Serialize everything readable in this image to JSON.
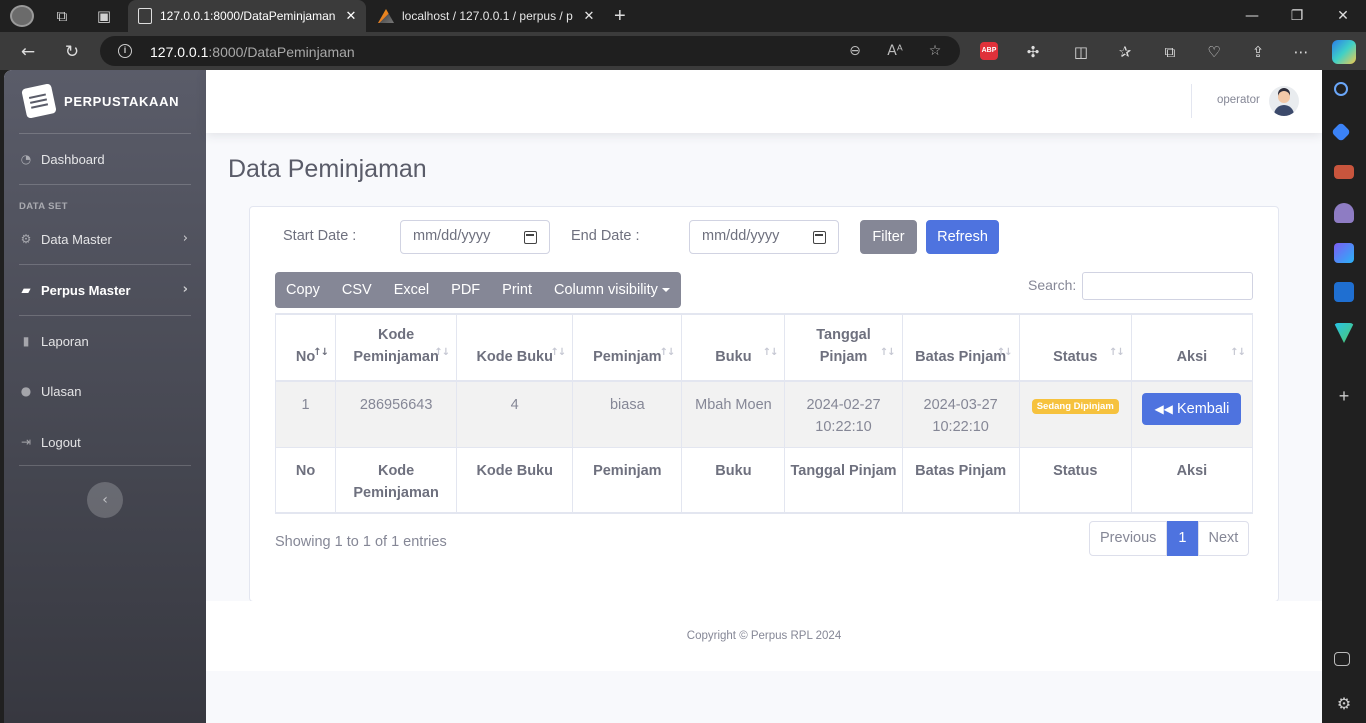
{
  "browser": {
    "tabs": [
      {
        "title": "127.0.0.1:8000/DataPeminjaman",
        "close": "✕"
      },
      {
        "title": "localhost / 127.0.0.1 / perpus / p",
        "close": "✕"
      }
    ],
    "new_tab": "+",
    "url_host": "127.0.0.1",
    "url_path": ":8000/DataPeminjaman",
    "abp_label": "ABP",
    "window_controls": {
      "minimize": "—",
      "maximize": "❐",
      "close": "✕"
    },
    "icons": {
      "workspaces": "workspaces-icon",
      "tab_actions": "tab-actions-icon",
      "back": "back-arrow-icon",
      "refresh": "refresh-icon",
      "zoom": "zoom-out-icon",
      "read_aloud": "read-aloud-icon",
      "favorite": "star-icon",
      "extensions": "puzzle-icon",
      "split_screen": "split-screen-icon",
      "favorites": "favorites-icon",
      "collections": "collections-icon",
      "health": "browser-essentials-icon",
      "share": "share-icon",
      "more": "more-icon",
      "copilot": "copilot-icon"
    }
  },
  "sidebar": {
    "brand": "PERPUSTAKAAN",
    "heading": "DATA SET",
    "items": [
      {
        "label": "Dashboard",
        "icon": "dashboard-icon"
      },
      {
        "label": "Data Master",
        "icon": "gear-icon",
        "chevron": "›"
      },
      {
        "label": "Perpus Master",
        "icon": "folder-open-icon",
        "chevron": "›"
      },
      {
        "label": "Laporan",
        "icon": "book-icon"
      },
      {
        "label": "Ulasan",
        "icon": "comments-icon"
      },
      {
        "label": "Logout",
        "icon": "sign-out-icon"
      }
    ],
    "toggle": "‹"
  },
  "topbar": {
    "user": "operator"
  },
  "page": {
    "title": "Data Peminjaman"
  },
  "filter": {
    "start_label": "Start Date :",
    "end_label": "End Date :",
    "start_placeholder": "mm/dd/yyyy",
    "end_placeholder": "mm/dd/yyyy",
    "filter_button": "Filter",
    "refresh_button": "Refresh"
  },
  "dt_buttons": [
    "Copy",
    "CSV",
    "Excel",
    "PDF",
    "Print"
  ],
  "column_visibility": "Column visibility",
  "search_label": "Search:",
  "table": {
    "headers": [
      "No",
      "Kode Peminjaman",
      "Kode Buku",
      "Peminjam",
      "Buku",
      "Tanggal Pinjam",
      "Batas Pinjam",
      "Status",
      "Aksi"
    ],
    "rows": [
      {
        "no": "1",
        "kode_peminjaman": "286956643",
        "kode_buku": "4",
        "peminjam": "biasa",
        "buku": "Mbah Moen",
        "tanggal_pinjam": "2024-02-27 10:22:10",
        "batas_pinjam": "2024-03-27 10:22:10",
        "status": "Sedang Dipinjam",
        "aksi": "Kembali"
      }
    ],
    "footer": [
      "No",
      "Kode Peminjaman",
      "Kode Buku",
      "Peminjam",
      "Buku",
      "Tanggal Pinjam",
      "Batas Pinjam",
      "Status",
      "Aksi"
    ]
  },
  "info": "Showing 1 to 1 of 1 entries",
  "pagination": {
    "previous": "Previous",
    "current": "1",
    "next": "Next"
  },
  "footer": {
    "copyright": "Copyright © Perpus RPL 2024"
  },
  "colors": {
    "primary": "#4e73df",
    "secondary": "#858796",
    "warning": "#f6c23e",
    "sidebar": "#5a5c69"
  }
}
